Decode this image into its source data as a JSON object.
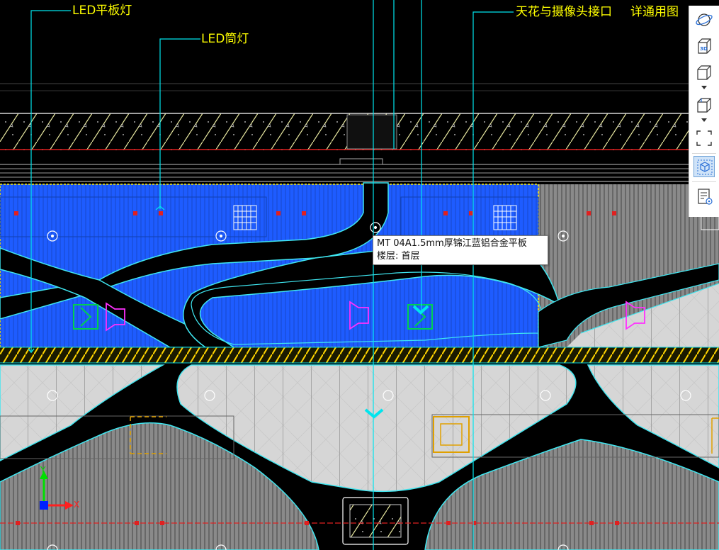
{
  "annotations": {
    "led_panel": "LED平板灯",
    "led_downlight": "LED筒灯",
    "ceiling_camera": "天花与摄像头接口",
    "detail_ref": "详通用图"
  },
  "tooltip": {
    "line1": "MT 04A1.5mm厚锦江蓝铝合金平板",
    "line2": "楼层: 首层"
  },
  "axes": {
    "x": "X",
    "y": "Y"
  },
  "toolbar": {
    "items": [
      "orbit-icon",
      "3d-view-icon",
      "cube-view-icon",
      "cube-view-icon",
      "zoom-extents-icon",
      "isolate-icon",
      "properties-icon"
    ],
    "badge_3d": "3D"
  },
  "colors": {
    "selection_blue": "#1e5cff",
    "cyan": "#00e5ee",
    "annotation_yellow": "#ffff00",
    "ceiling_grey": "#7f7f7f",
    "light_grey": "#d4d4d4"
  }
}
